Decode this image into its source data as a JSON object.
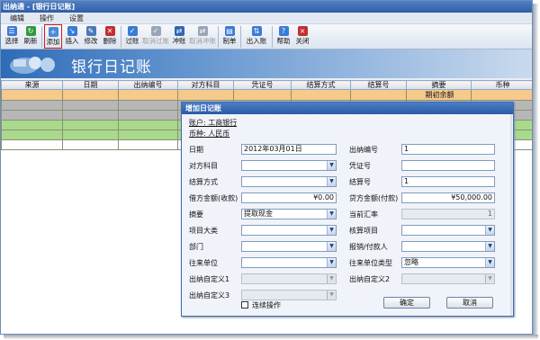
{
  "app": {
    "title": "出纳通 - [银行日记账]"
  },
  "menu": [
    "编辑",
    "操作",
    "设置"
  ],
  "toolbar": [
    {
      "label": "选择",
      "icon": "select-icon",
      "color": "#3a7bd5"
    },
    {
      "label": "刷新",
      "icon": "refresh-icon",
      "color": "#2e9a3e"
    },
    {
      "label": "添加",
      "icon": "add-icon",
      "color": "#4b8ad8",
      "active": true
    },
    {
      "label": "插入",
      "icon": "insert-icon",
      "color": "#3a7bd5"
    },
    {
      "label": "修改",
      "icon": "edit-icon",
      "color": "#4a78b8"
    },
    {
      "label": "删除",
      "icon": "delete-icon",
      "color": "#c03030"
    },
    {
      "label": "过账",
      "icon": "post-icon",
      "color": "#3a7bd5"
    },
    {
      "label": "取消过账",
      "icon": "unpost-icon",
      "color": "#9aa5b5",
      "disabled": true
    },
    {
      "label": "冲账",
      "icon": "reverse-icon",
      "color": "#2f68b8"
    },
    {
      "label": "取消冲账",
      "icon": "unreverse-icon",
      "color": "#9aa5b5",
      "disabled": true
    },
    {
      "label": "制单",
      "icon": "voucher-icon",
      "color": "#3a7bd5"
    },
    {
      "label": "出入账",
      "icon": "inout-icon",
      "color": "#3a7bd5"
    },
    {
      "label": "帮助",
      "icon": "help-icon",
      "color": "#3a7bd5"
    },
    {
      "label": "关闭",
      "icon": "close-icon",
      "color": "#c03030"
    }
  ],
  "banner": {
    "title": "银行日记账"
  },
  "grid": {
    "columns": [
      "来源",
      "日期",
      "出纳编号",
      "对方科目",
      "凭证号",
      "结算方式",
      "结算号",
      "摘要",
      "币种"
    ],
    "summary_row_text": "期初余额"
  },
  "dialog": {
    "title": "增加日记账",
    "account": "账户: 工商银行",
    "currency": "币种: 人民币",
    "left": {
      "date_label": "日期",
      "date_value": "2012年03月01日",
      "counter_label": "对方科目",
      "counter_value": "",
      "settle_label": "结算方式",
      "settle_value": "",
      "debit_label": "借方金额(收款)",
      "debit_value": "¥0.00",
      "summary_label": "摘要",
      "summary_value": "提取现金",
      "category_label": "项目大类",
      "category_value": "",
      "dept_label": "部门",
      "dept_value": "",
      "partner_label": "往来单位",
      "partner_value": "",
      "custom1_label": "出纳自定义1",
      "custom1_value": "",
      "custom3_label": "出纳自定义3",
      "custom3_value": ""
    },
    "right": {
      "cashier_no_label": "出纳编号",
      "cashier_no_value": "1",
      "voucher_label": "凭证号",
      "voucher_value": "",
      "settle_no_label": "结算号",
      "settle_no_value": "1",
      "credit_label": "贷方金额(付款)",
      "credit_value": "¥50,000.00",
      "rate_label": "当前汇率",
      "rate_value": "1",
      "item_label": "核算项目",
      "item_value": "",
      "payee_label": "报销/付款人",
      "payee_value": "",
      "partner_type_label": "往来单位类型",
      "partner_type_value": "忽略",
      "custom2_label": "出纳自定义2",
      "custom2_value": ""
    },
    "continuous_label": "连续操作",
    "ok_label": "确定",
    "cancel_label": "取消"
  }
}
